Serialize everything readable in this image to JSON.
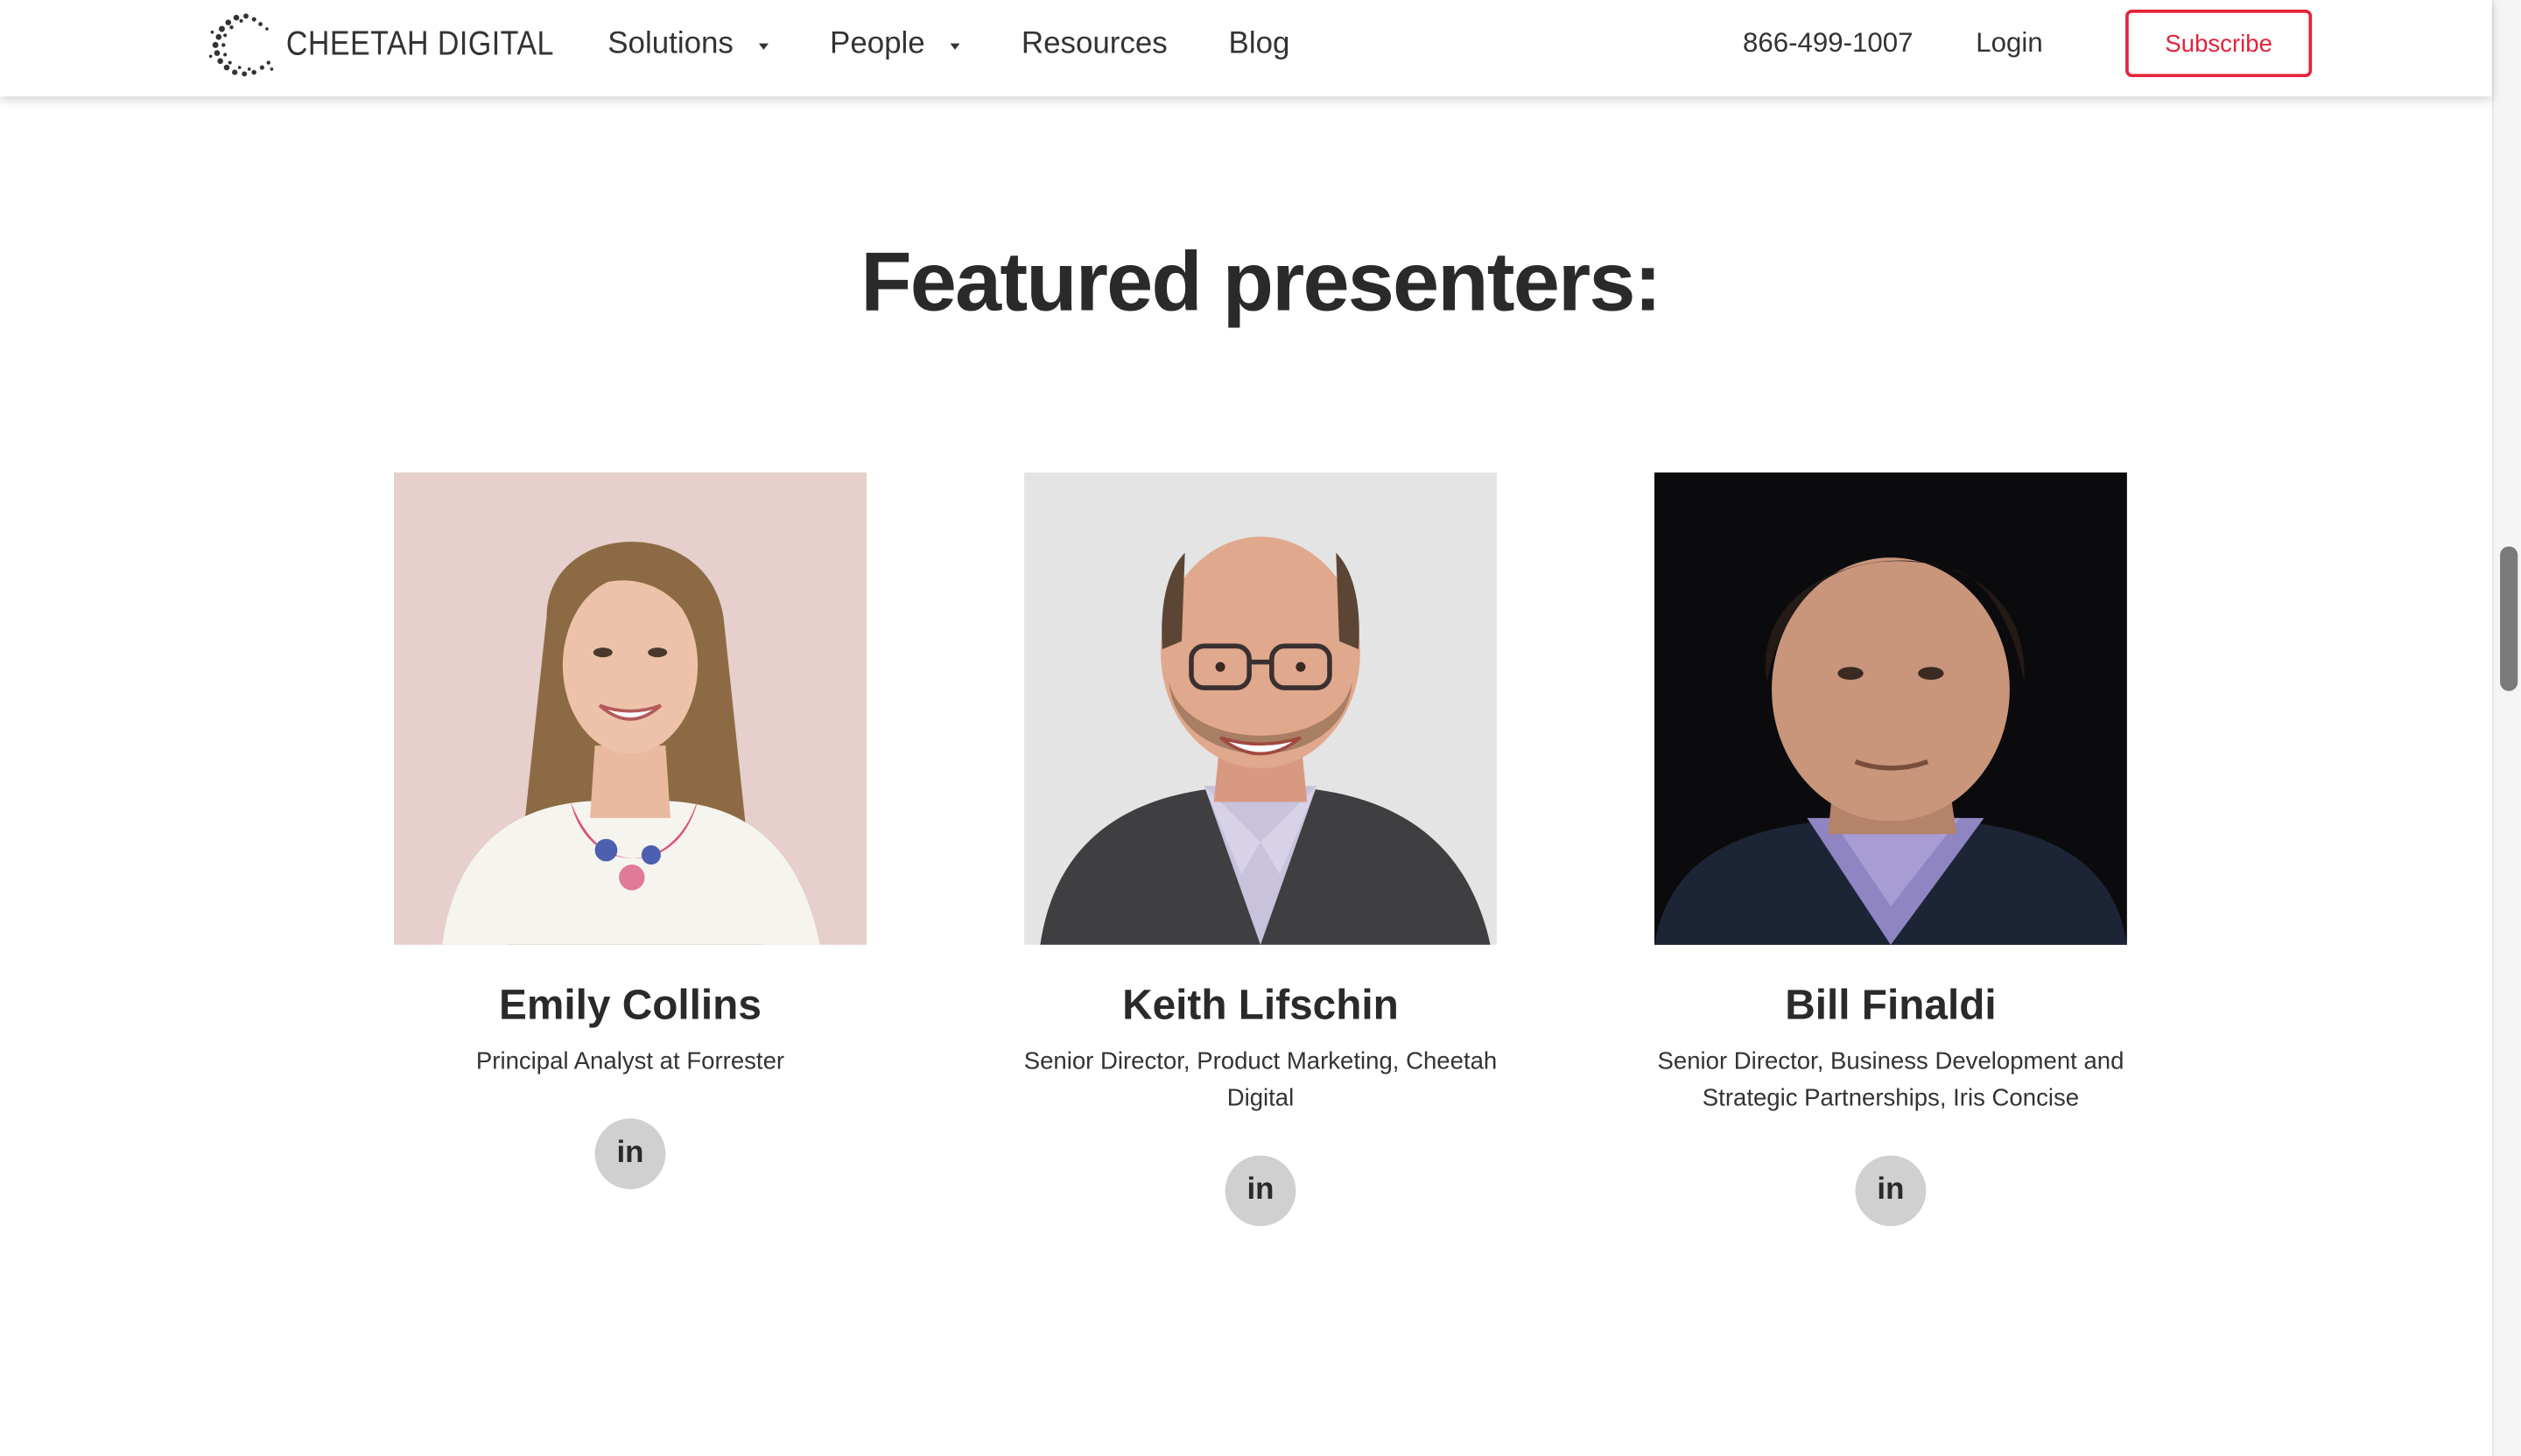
{
  "header": {
    "logo_text": "CHEETAH DIGITAL",
    "nav": [
      {
        "label": "Solutions",
        "has_dropdown": true
      },
      {
        "label": "People",
        "has_dropdown": true
      },
      {
        "label": "Resources",
        "has_dropdown": false
      },
      {
        "label": "Blog",
        "has_dropdown": false
      }
    ],
    "phone": "866-499-1007",
    "login_label": "Login",
    "subscribe_label": "Subscribe"
  },
  "colors": {
    "accent": "#e2233b",
    "text": "#2b2b2b",
    "icon_bg": "#d0d0d0"
  },
  "main": {
    "title": "Featured presenters:",
    "presenters": [
      {
        "name": "Emily Collins",
        "role": "Principal Analyst at Forrester",
        "social_icon": "linkedin-icon",
        "social_glyph": "in"
      },
      {
        "name": "Keith Lifschin",
        "role": "Senior Director, Product Marketing, Cheetah Digital",
        "social_icon": "linkedin-icon",
        "social_glyph": "in"
      },
      {
        "name": "Bill Finaldi",
        "role": "Senior Director, Business Development and Strategic Partnerships, Iris Concise",
        "social_icon": "linkedin-icon",
        "social_glyph": "in"
      }
    ]
  }
}
